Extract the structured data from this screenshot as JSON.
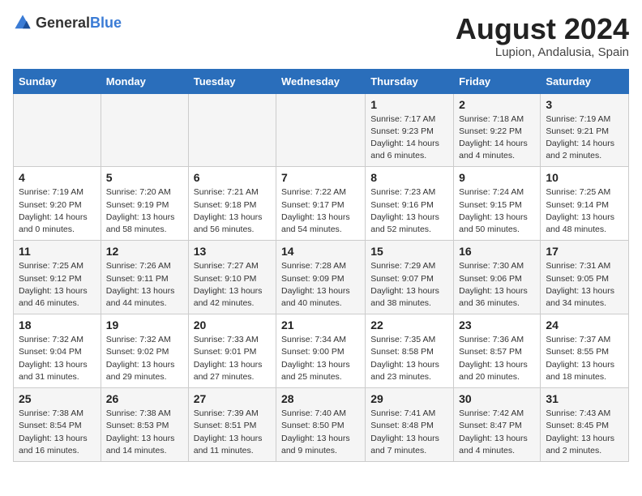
{
  "header": {
    "logo_general": "General",
    "logo_blue": "Blue",
    "month_year": "August 2024",
    "location": "Lupion, Andalusia, Spain"
  },
  "days_of_week": [
    "Sunday",
    "Monday",
    "Tuesday",
    "Wednesday",
    "Thursday",
    "Friday",
    "Saturday"
  ],
  "weeks": [
    [
      {
        "num": "",
        "info": ""
      },
      {
        "num": "",
        "info": ""
      },
      {
        "num": "",
        "info": ""
      },
      {
        "num": "",
        "info": ""
      },
      {
        "num": "1",
        "info": "Sunrise: 7:17 AM\nSunset: 9:23 PM\nDaylight: 14 hours and 6 minutes."
      },
      {
        "num": "2",
        "info": "Sunrise: 7:18 AM\nSunset: 9:22 PM\nDaylight: 14 hours and 4 minutes."
      },
      {
        "num": "3",
        "info": "Sunrise: 7:19 AM\nSunset: 9:21 PM\nDaylight: 14 hours and 2 minutes."
      }
    ],
    [
      {
        "num": "4",
        "info": "Sunrise: 7:19 AM\nSunset: 9:20 PM\nDaylight: 14 hours and 0 minutes."
      },
      {
        "num": "5",
        "info": "Sunrise: 7:20 AM\nSunset: 9:19 PM\nDaylight: 13 hours and 58 minutes."
      },
      {
        "num": "6",
        "info": "Sunrise: 7:21 AM\nSunset: 9:18 PM\nDaylight: 13 hours and 56 minutes."
      },
      {
        "num": "7",
        "info": "Sunrise: 7:22 AM\nSunset: 9:17 PM\nDaylight: 13 hours and 54 minutes."
      },
      {
        "num": "8",
        "info": "Sunrise: 7:23 AM\nSunset: 9:16 PM\nDaylight: 13 hours and 52 minutes."
      },
      {
        "num": "9",
        "info": "Sunrise: 7:24 AM\nSunset: 9:15 PM\nDaylight: 13 hours and 50 minutes."
      },
      {
        "num": "10",
        "info": "Sunrise: 7:25 AM\nSunset: 9:14 PM\nDaylight: 13 hours and 48 minutes."
      }
    ],
    [
      {
        "num": "11",
        "info": "Sunrise: 7:25 AM\nSunset: 9:12 PM\nDaylight: 13 hours and 46 minutes."
      },
      {
        "num": "12",
        "info": "Sunrise: 7:26 AM\nSunset: 9:11 PM\nDaylight: 13 hours and 44 minutes."
      },
      {
        "num": "13",
        "info": "Sunrise: 7:27 AM\nSunset: 9:10 PM\nDaylight: 13 hours and 42 minutes."
      },
      {
        "num": "14",
        "info": "Sunrise: 7:28 AM\nSunset: 9:09 PM\nDaylight: 13 hours and 40 minutes."
      },
      {
        "num": "15",
        "info": "Sunrise: 7:29 AM\nSunset: 9:07 PM\nDaylight: 13 hours and 38 minutes."
      },
      {
        "num": "16",
        "info": "Sunrise: 7:30 AM\nSunset: 9:06 PM\nDaylight: 13 hours and 36 minutes."
      },
      {
        "num": "17",
        "info": "Sunrise: 7:31 AM\nSunset: 9:05 PM\nDaylight: 13 hours and 34 minutes."
      }
    ],
    [
      {
        "num": "18",
        "info": "Sunrise: 7:32 AM\nSunset: 9:04 PM\nDaylight: 13 hours and 31 minutes."
      },
      {
        "num": "19",
        "info": "Sunrise: 7:32 AM\nSunset: 9:02 PM\nDaylight: 13 hours and 29 minutes."
      },
      {
        "num": "20",
        "info": "Sunrise: 7:33 AM\nSunset: 9:01 PM\nDaylight: 13 hours and 27 minutes."
      },
      {
        "num": "21",
        "info": "Sunrise: 7:34 AM\nSunset: 9:00 PM\nDaylight: 13 hours and 25 minutes."
      },
      {
        "num": "22",
        "info": "Sunrise: 7:35 AM\nSunset: 8:58 PM\nDaylight: 13 hours and 23 minutes."
      },
      {
        "num": "23",
        "info": "Sunrise: 7:36 AM\nSunset: 8:57 PM\nDaylight: 13 hours and 20 minutes."
      },
      {
        "num": "24",
        "info": "Sunrise: 7:37 AM\nSunset: 8:55 PM\nDaylight: 13 hours and 18 minutes."
      }
    ],
    [
      {
        "num": "25",
        "info": "Sunrise: 7:38 AM\nSunset: 8:54 PM\nDaylight: 13 hours and 16 minutes."
      },
      {
        "num": "26",
        "info": "Sunrise: 7:38 AM\nSunset: 8:53 PM\nDaylight: 13 hours and 14 minutes."
      },
      {
        "num": "27",
        "info": "Sunrise: 7:39 AM\nSunset: 8:51 PM\nDaylight: 13 hours and 11 minutes."
      },
      {
        "num": "28",
        "info": "Sunrise: 7:40 AM\nSunset: 8:50 PM\nDaylight: 13 hours and 9 minutes."
      },
      {
        "num": "29",
        "info": "Sunrise: 7:41 AM\nSunset: 8:48 PM\nDaylight: 13 hours and 7 minutes."
      },
      {
        "num": "30",
        "info": "Sunrise: 7:42 AM\nSunset: 8:47 PM\nDaylight: 13 hours and 4 minutes."
      },
      {
        "num": "31",
        "info": "Sunrise: 7:43 AM\nSunset: 8:45 PM\nDaylight: 13 hours and 2 minutes."
      }
    ]
  ]
}
